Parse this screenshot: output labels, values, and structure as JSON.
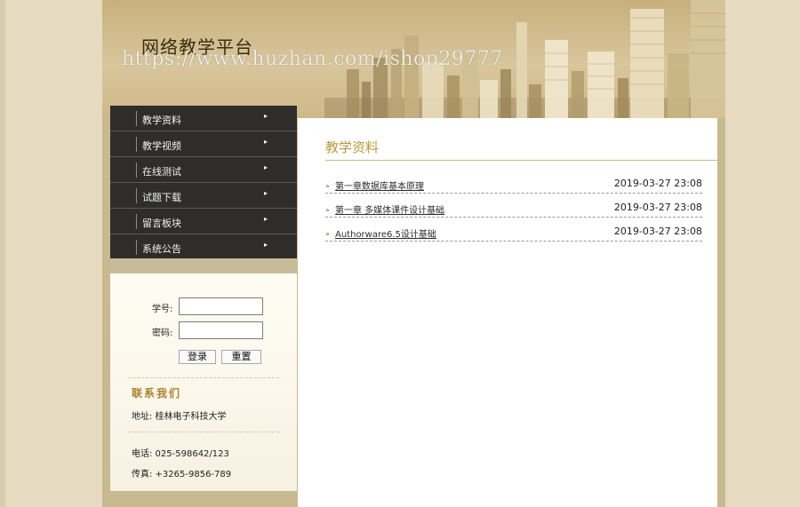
{
  "header": {
    "site_title": "网络教学平台",
    "watermark": "https://www.huzhan.com/ishop29777"
  },
  "nav": {
    "items": [
      {
        "label": "教学资料"
      },
      {
        "label": "教学视频"
      },
      {
        "label": "在线测试"
      },
      {
        "label": "试题下载"
      },
      {
        "label": "留言板块"
      },
      {
        "label": "系统公告"
      }
    ],
    "arrow": "▸"
  },
  "login": {
    "student_id_label": "学号:",
    "password_label": "密码:",
    "student_id_value": "",
    "password_value": "",
    "login_button": "登录",
    "reset_button": "重置"
  },
  "contact": {
    "title": "联系我们",
    "address": "地址: 桂林电子科技大学",
    "phone": "电话: 025-598642/123",
    "fax": "传真: +3265-9856-789"
  },
  "main": {
    "title": "教学资料",
    "bullet": "»",
    "rows": [
      {
        "title": "第一章数据库基本原理",
        "date": "2019-03-27 23:08"
      },
      {
        "title": "第一章 多媒体课件设计基础",
        "date": "2019-03-27 23:08"
      },
      {
        "title": "Authorware6.5设计基础",
        "date": "2019-03-27 23:08"
      }
    ]
  }
}
